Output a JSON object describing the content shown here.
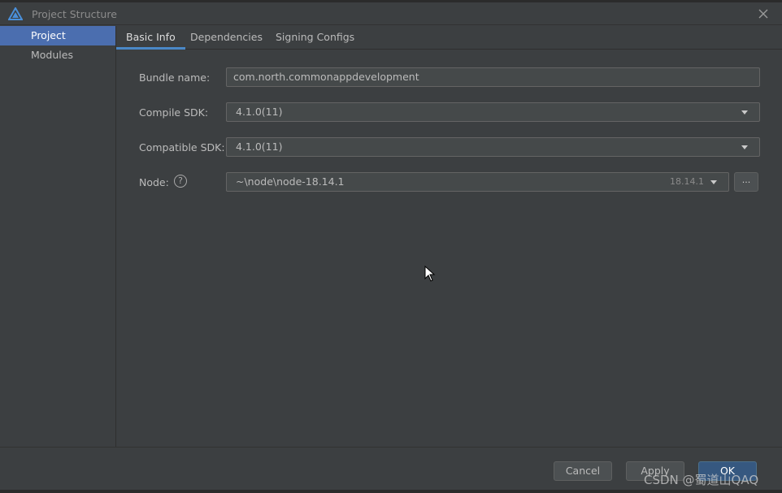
{
  "window": {
    "title": "Project Structure",
    "close_icon": "close-icon",
    "app_icon": "harmony-logo-icon"
  },
  "sidebar": {
    "items": [
      {
        "label": "Project",
        "active": true
      },
      {
        "label": "Modules",
        "active": false
      }
    ]
  },
  "tabs": [
    {
      "label": "Basic Info",
      "active": true
    },
    {
      "label": "Dependencies",
      "active": false
    },
    {
      "label": "Signing Configs",
      "active": false
    }
  ],
  "form": {
    "bundle_name": {
      "label": "Bundle name:",
      "value": "com.north.commonappdevelopment"
    },
    "compile_sdk": {
      "label": "Compile SDK:",
      "value": "4.1.0(11)"
    },
    "compatible_sdk": {
      "label": "Compatible SDK:",
      "value": "4.1.0(11)"
    },
    "node": {
      "label": "Node:",
      "help": "?",
      "value": "~\\node\\node-18.14.1",
      "version": "18.14.1",
      "browse": "..."
    }
  },
  "footer": {
    "cancel": "Cancel",
    "apply": "Apply",
    "ok": "OK",
    "watermark": "CSDN @蜀道山QAQ"
  },
  "colors": {
    "accent": "#4b6eaf",
    "tab_underline": "#4a88c7",
    "ok_button": "#365880"
  }
}
